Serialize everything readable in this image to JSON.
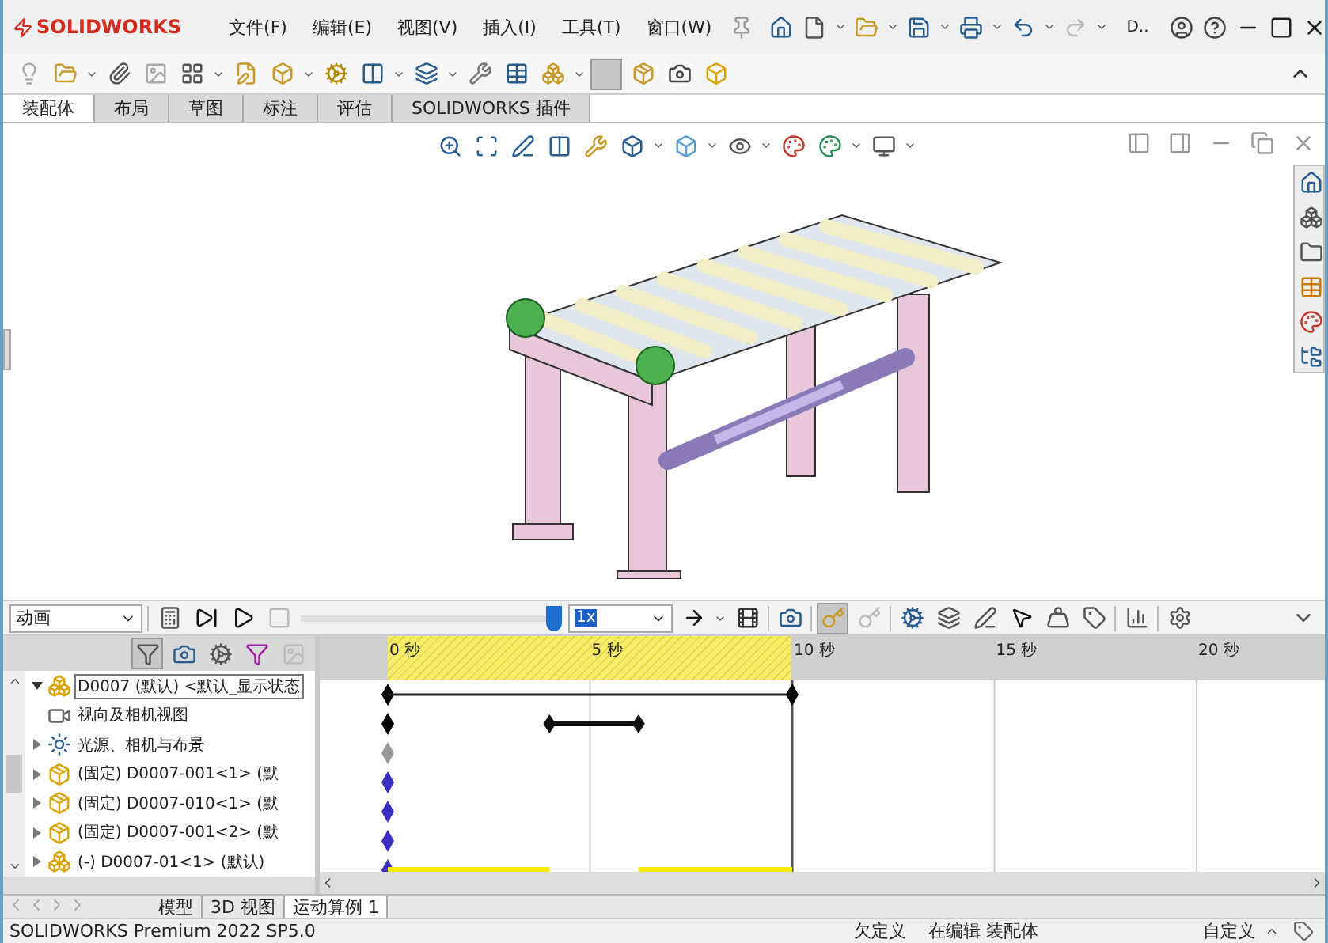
{
  "app": {
    "logo": "SOLIDWORKS",
    "menus": [
      "文件(F)",
      "编辑(E)",
      "视图(V)",
      "插入(I)",
      "工具(T)",
      "窗口(W)"
    ],
    "doc_short": "D.."
  },
  "command_tabs": [
    {
      "label": "装配体",
      "selected": true
    },
    {
      "label": "布局",
      "selected": false
    },
    {
      "label": "草图",
      "selected": false
    },
    {
      "label": "标注",
      "selected": false
    },
    {
      "label": "评估",
      "selected": false
    },
    {
      "label": "SOLIDWORKS 插件",
      "selected": false
    }
  ],
  "motion_toolbar": {
    "study_type": "动画",
    "level": 0.97,
    "speed": "1x"
  },
  "timeline": {
    "ticks": [
      "0 秒",
      "5 秒",
      "10 秒",
      "15 秒",
      "20 秒"
    ]
  },
  "tree": [
    {
      "label": "D0007 (默认) <默认_显示状态",
      "kind": "assembly",
      "expanded": true,
      "selected": true,
      "color": "#000000"
    },
    {
      "label": "视向及相机视图",
      "kind": "camera",
      "selected": false,
      "color": "#000000"
    },
    {
      "label": "光源、相机与布景",
      "kind": "folder",
      "expanded": false,
      "selected": false,
      "color": "#999999"
    },
    {
      "label": "(固定) D0007-001<1> (默",
      "kind": "part",
      "expanded": false,
      "selected": false,
      "color": "#3a2fc0"
    },
    {
      "label": "(固定) D0007-010<1> (默",
      "kind": "part",
      "expanded": false,
      "selected": false,
      "color": "#3a2fc0"
    },
    {
      "label": "(固定) D0007-001<2> (默",
      "kind": "part",
      "expanded": false,
      "selected": false,
      "color": "#3a2fc0"
    },
    {
      "label": "(-) D0007-01<1> (默认)",
      "kind": "assembly",
      "expanded": false,
      "selected": false,
      "color": "#3a2fc0"
    }
  ],
  "bottom_tabs": [
    {
      "label": "模型",
      "selected": false
    },
    {
      "label": "3D 视图",
      "selected": false
    },
    {
      "label": "运动算例 1",
      "selected": true
    }
  ],
  "status_bar": {
    "product": "SOLIDWORKS Premium 2022 SP5.0",
    "state": "欠定义",
    "mode": "在编辑 装配体",
    "units": "自定义"
  }
}
